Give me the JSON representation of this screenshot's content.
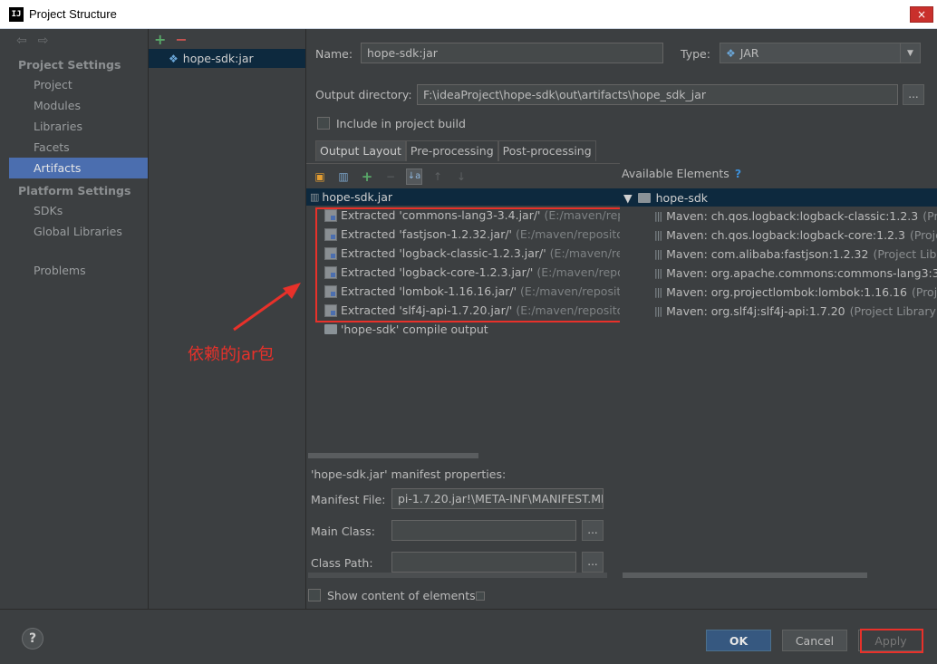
{
  "window": {
    "title": "Project Structure",
    "close_label": "×",
    "app_icon": "IJ"
  },
  "nav": {
    "back_icon": "⇦",
    "forward_icon": "⇨",
    "section_project": "Project Settings",
    "items_project": [
      "Project",
      "Modules",
      "Libraries",
      "Facets",
      "Artifacts"
    ],
    "section_platform": "Platform Settings",
    "items_platform": [
      "SDKs",
      "Global Libraries"
    ],
    "problems": "Problems",
    "selected": "Artifacts"
  },
  "artifacts": {
    "add_icon": "+",
    "remove_icon": "−",
    "items": [
      "hope-sdk:jar"
    ]
  },
  "form": {
    "name_label": "Name:",
    "name_value": "hope-sdk:jar",
    "type_label": "Type:",
    "type_value": "JAR",
    "output_dir_label": "Output directory:",
    "output_dir_value": "F:\\ideaProject\\hope-sdk\\out\\artifacts\\hope_sdk_jar",
    "browse_label": "...",
    "include_build_label": "Include in project build"
  },
  "tabs": [
    "Output Layout",
    "Pre-processing",
    "Post-processing"
  ],
  "layout": {
    "root": "hope-sdk.jar",
    "extracted": [
      {
        "name": "Extracted 'commons-lang3-3.4.jar/'",
        "path": "(E:/maven/reposit"
      },
      {
        "name": "Extracted 'fastjson-1.2.32.jar/'",
        "path": "(E:/maven/repository/c"
      },
      {
        "name": "Extracted 'logback-classic-1.2.3.jar/'",
        "path": "(E:/maven/repos"
      },
      {
        "name": "Extracted 'logback-core-1.2.3.jar/'",
        "path": "(E:/maven/reposito"
      },
      {
        "name": "Extracted 'lombok-1.16.16.jar/'",
        "path": "(E:/maven/repository/"
      },
      {
        "name": "Extracted 'slf4j-api-1.7.20.jar/'",
        "path": "(E:/maven/repository/c"
      }
    ],
    "compile_output": "'hope-sdk' compile output"
  },
  "annotation": "依赖的jar包",
  "available": {
    "header": "Available Elements",
    "help": "?",
    "root": "hope-sdk",
    "items": [
      {
        "name": "Maven: ch.qos.logback:logback-classic:1.2.3",
        "suffix": "(Proje"
      },
      {
        "name": "Maven: ch.qos.logback:logback-core:1.2.3",
        "suffix": "(Project"
      },
      {
        "name": "Maven: com.alibaba:fastjson:1.2.32",
        "suffix": "(Project Library"
      },
      {
        "name": "Maven: org.apache.commons:commons-lang3:3.4",
        "suffix": ""
      },
      {
        "name": "Maven: org.projectlombok:lombok:1.16.16",
        "suffix": "(Projec"
      },
      {
        "name": "Maven: org.slf4j:slf4j-api:1.7.20",
        "suffix": "(Project Library)"
      }
    ]
  },
  "manifest": {
    "title": "'hope-sdk.jar' manifest properties:",
    "file_label": "Manifest File:",
    "file_value": "pi-1.7.20.jar!\\META-INF\\MANIFEST.MF",
    "main_class_label": "Main Class:",
    "main_class_value": "",
    "class_path_label": "Class Path:",
    "class_path_value": "",
    "show_content_label": "Show content of elements"
  },
  "buttons": {
    "help": "?",
    "ok": "OK",
    "cancel": "Cancel",
    "apply": "Apply"
  },
  "colors": {
    "selection": "#4b6eaf",
    "annotation": "#e8312a",
    "tree_selection": "#0d293e"
  }
}
